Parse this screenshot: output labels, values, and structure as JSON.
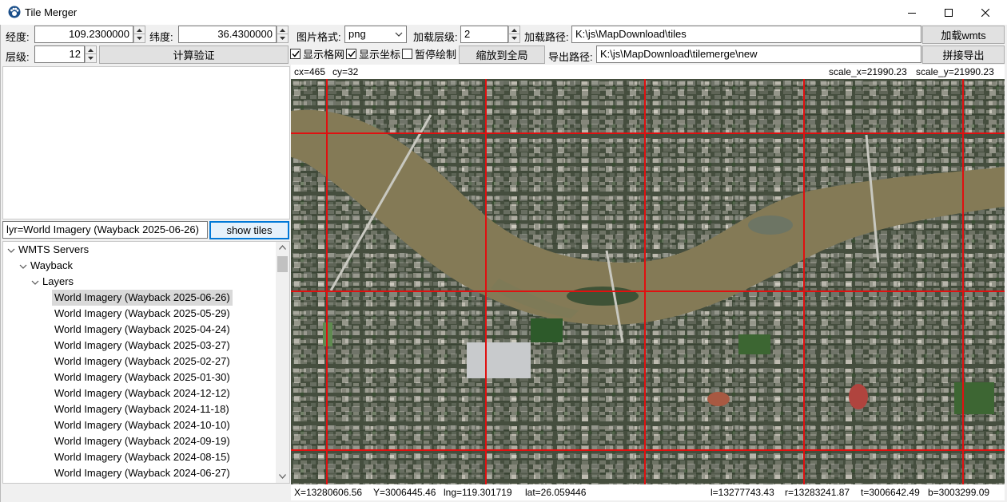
{
  "window": {
    "title": "Tile Merger"
  },
  "icons": {
    "app": "paw-icon",
    "minimize": "minimize-icon",
    "maximize": "maximize-icon",
    "close": "close-icon",
    "spin_up": "triangle-up-icon",
    "spin_down": "triangle-down-icon",
    "dropdown": "chevron-down-icon",
    "checkbox": "check-icon",
    "tree_expand": "chevron-down-icon"
  },
  "controls": {
    "lng_label": "经度:",
    "lng_value": "109.2300000",
    "lat_label": "纬度:",
    "lat_value": "36.4300000",
    "level_label": "层级:",
    "level_value": "12",
    "compute_button": "计算验证",
    "format_label": "图片格式:",
    "format_value": "png",
    "load_level_label": "加载层级:",
    "load_level_value": "2",
    "load_path_label": "加载路径:",
    "load_path_value": "K:\\js\\MapDownload\\tiles",
    "load_wmts_button": "加载wmts",
    "show_grid_label": "显示格网",
    "show_grid_checked": true,
    "show_coords_label": "显示坐标",
    "show_coords_checked": true,
    "pause_draw_label": "暂停绘制",
    "pause_draw_checked": false,
    "zoom_all_button": "缩放到全局",
    "export_path_label": "导出路径:",
    "export_path_value": "K:\\js\\MapDownload\\tilemerge\\new",
    "merge_export_button": "拼接导出"
  },
  "layer_field": {
    "value": "lyr=World Imagery (Wayback 2025-06-26)",
    "button": "show tiles"
  },
  "tree": {
    "root": "WMTS Servers",
    "child": "Wayback",
    "group": "Layers",
    "selected_index": 0,
    "items": [
      "World Imagery (Wayback 2025-06-26)",
      "World Imagery (Wayback 2025-05-29)",
      "World Imagery (Wayback 2025-04-24)",
      "World Imagery (Wayback 2025-03-27)",
      "World Imagery (Wayback 2025-02-27)",
      "World Imagery (Wayback 2025-01-30)",
      "World Imagery (Wayback 2024-12-12)",
      "World Imagery (Wayback 2024-11-18)",
      "World Imagery (Wayback 2024-10-10)",
      "World Imagery (Wayback 2024-09-19)",
      "World Imagery (Wayback 2024-08-15)",
      "World Imagery (Wayback 2024-06-27)"
    ]
  },
  "map": {
    "cx": "cx=465",
    "cy": "cy=32",
    "scale_x": "scale_x=21990.23",
    "scale_y": "scale_y=21990.23",
    "X": "X=13280606.56",
    "Y": "Y=3006445.46",
    "lng": "lng=119.301719",
    "lat": "lat=26.059446",
    "l": "l=13277743.43",
    "r": "r=13283241.87",
    "t": "t=3006642.49",
    "b": "b=3003299.09",
    "grid_color": "#e01010",
    "river_color": "#847a56"
  }
}
